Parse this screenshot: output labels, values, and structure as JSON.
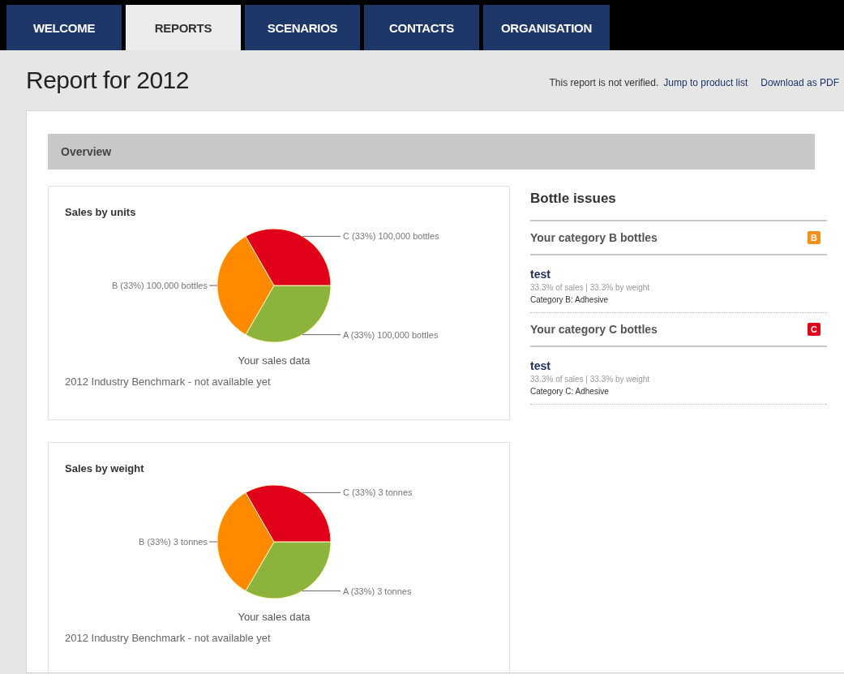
{
  "tabs": [
    {
      "label": "WELCOME",
      "selected": false
    },
    {
      "label": "REPORTS",
      "selected": true
    },
    {
      "label": "SCENARIOS",
      "selected": false
    },
    {
      "label": "CONTACTS",
      "selected": false
    },
    {
      "label": "ORGANISATION",
      "selected": false
    }
  ],
  "page": {
    "title": "Report for 2012",
    "status": "This report is not verified.",
    "links": [
      "Jump to product list",
      "Download as PDF"
    ]
  },
  "overview": {
    "title": "Overview"
  },
  "charts": [
    {
      "caption": "Your sales data",
      "note": "2012 Industry Benchmark - not available yet",
      "chart_data": {
        "type": "pie",
        "title": "Sales by units",
        "categories": [
          "A (33%) 100,000 bottles",
          "B (33%) 100,000 bottles",
          "C (33%) 100,000 bottles"
        ],
        "values": [
          33,
          33,
          33
        ],
        "colors": [
          "#8cb43c",
          "#ff8a00",
          "#e0001a"
        ]
      }
    },
    {
      "caption": "Your sales data",
      "note": "2012 Industry Benchmark - not available yet",
      "chart_data": {
        "type": "pie",
        "title": "Sales by weight",
        "categories": [
          "A (33%) 3 tonnes",
          "B (33%) 3 tonnes",
          "C (33%) 3 tonnes"
        ],
        "values": [
          33,
          33,
          33
        ],
        "colors": [
          "#8cb43c",
          "#ff8a00",
          "#e0001a"
        ]
      }
    }
  ],
  "issues": {
    "title": "Bottle issues",
    "groups": [
      {
        "title": "Your category B bottles",
        "badge": "B",
        "color": "#f39019",
        "items": [
          {
            "name": "test",
            "stats": "33.3% of sales | 33.3% by weight",
            "category": "Category B: Adhesive"
          }
        ]
      },
      {
        "title": "Your category C bottles",
        "badge": "C",
        "color": "#e2001a",
        "items": [
          {
            "name": "test",
            "stats": "33.3% of sales | 33.3% by weight",
            "category": "Category C: Adhesive"
          }
        ]
      }
    ]
  }
}
